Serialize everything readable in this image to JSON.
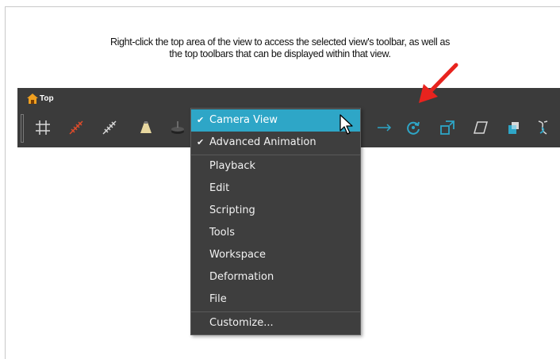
{
  "caption": {
    "line1": "Right-click the top area of the view to access the selected view's toolbar, as well as",
    "line2": "the top toolbars that can be displayed within that view."
  },
  "view": {
    "title": "Top"
  },
  "toolbar_icons": [
    "grid-icon",
    "red-ruler-icon",
    "white-ruler-icon",
    "light-cone-icon",
    "stack-icon",
    "motion-icon",
    "rotate-icon",
    "scale-icon",
    "skew-icon",
    "sq-icon",
    "twist-icon"
  ],
  "menu": {
    "items": [
      {
        "label": "Camera View",
        "checked": true,
        "highlighted": true
      },
      {
        "label": "Advanced Animation",
        "checked": true
      },
      {
        "label": "Playback"
      },
      {
        "label": "Edit"
      },
      {
        "label": "Scripting"
      },
      {
        "label": "Tools"
      },
      {
        "label": "Workspace"
      },
      {
        "label": "Deformation"
      },
      {
        "label": "File"
      },
      {
        "label": "Customize..."
      }
    ]
  },
  "colors": {
    "highlight": "#2ea6c7",
    "arrow": "#e8231e",
    "view_bg": "#3b3b3b",
    "menu_bg": "#3e3e3e"
  }
}
